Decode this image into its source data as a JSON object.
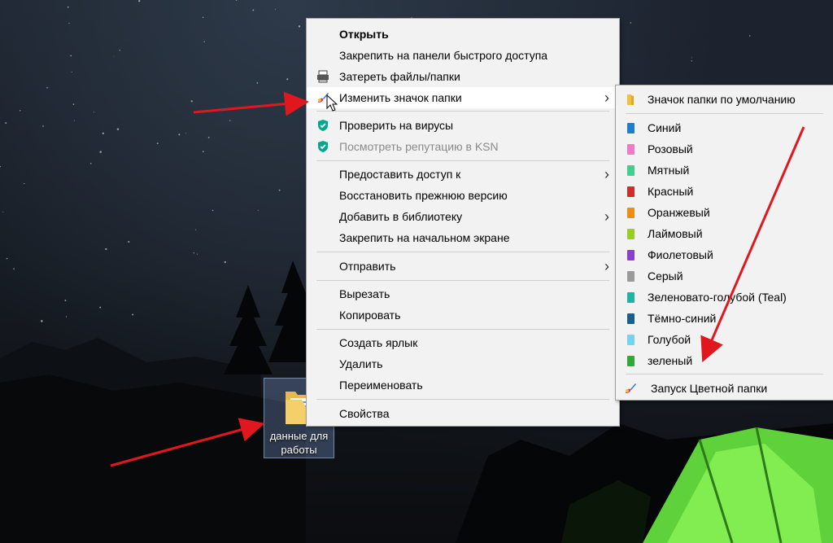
{
  "desktop": {
    "folder_label": "данные для работы"
  },
  "context_menu": {
    "items": [
      {
        "label": "Открыть"
      },
      {
        "label": "Закрепить на панели быстрого доступа"
      },
      {
        "label": "Затереть файлы/папки"
      },
      {
        "label": "Изменить значок папки"
      },
      {
        "label": "Проверить на вирусы"
      },
      {
        "label": "Посмотреть репутацию в KSN"
      },
      {
        "label": "Предоставить доступ к"
      },
      {
        "label": "Восстановить прежнюю версию"
      },
      {
        "label": "Добавить в библиотеку"
      },
      {
        "label": "Закрепить на начальном экране"
      },
      {
        "label": "Отправить"
      },
      {
        "label": "Вырезать"
      },
      {
        "label": "Копировать"
      },
      {
        "label": "Создать ярлык"
      },
      {
        "label": "Удалить"
      },
      {
        "label": "Переименовать"
      },
      {
        "label": "Свойства"
      }
    ]
  },
  "submenu": {
    "default_label": "Значок папки по умолчанию",
    "colors": [
      {
        "label": "Синий",
        "color": "#1e7fd0"
      },
      {
        "label": "Розовый",
        "color": "#f07ac8"
      },
      {
        "label": "Мятный",
        "color": "#3fcf8e"
      },
      {
        "label": "Красный",
        "color": "#d42a2a"
      },
      {
        "label": "Оранжевый",
        "color": "#f08c10"
      },
      {
        "label": "Лаймовый",
        "color": "#9acd22"
      },
      {
        "label": "Фиолетовый",
        "color": "#8a3fd0"
      },
      {
        "label": "Серый",
        "color": "#9a9a9a"
      },
      {
        "label": "Зеленовато-голубой (Teal)",
        "color": "#1fb5a5"
      },
      {
        "label": "Тёмно-синий",
        "color": "#1a5f8a"
      },
      {
        "label": "Голубой",
        "color": "#6fd6f0"
      },
      {
        "label": "зеленый",
        "color": "#2faa3a"
      }
    ],
    "launch_label": "Запуск Цветной папки"
  }
}
